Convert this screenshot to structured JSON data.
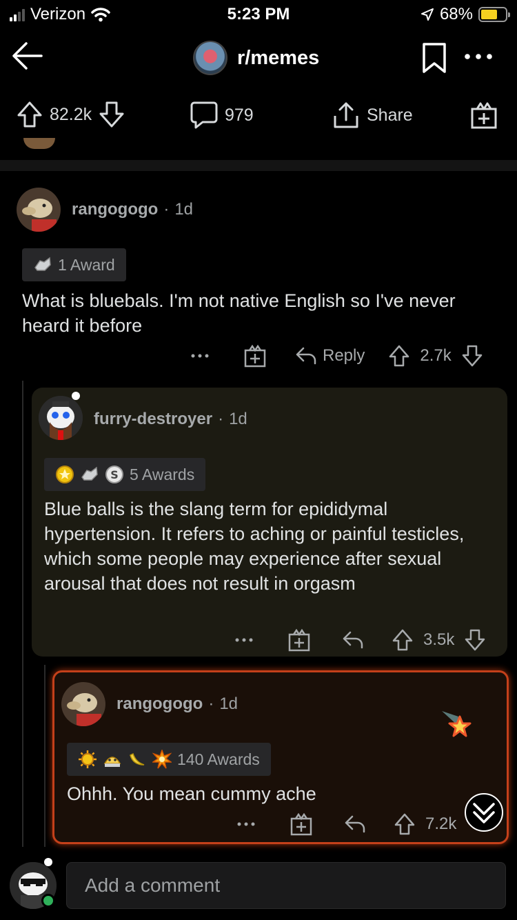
{
  "status": {
    "carrier": "Verizon",
    "time": "5:23 PM",
    "battery": "68%"
  },
  "header": {
    "subreddit": "r/memes"
  },
  "actionbar": {
    "score": "82.2k",
    "comments": "979",
    "share_label": "Share"
  },
  "comments": [
    {
      "author": "rangogogo",
      "age": "1d",
      "awards_label": "1 Award",
      "body": "What is bluebals. I'm not native English so I've never heard it before",
      "reply_label": "Reply",
      "score": "2.7k"
    },
    {
      "author": "furry-destroyer",
      "age": "1d",
      "awards_label": "5 Awards",
      "body": "Blue balls is the slang term for epididymal hypertension. It refers to aching or painful testicles, which some people may experience after sexual arousal that does not result in orgasm",
      "score": "3.5k"
    },
    {
      "author": "rangogogo",
      "age": "1d",
      "awards_label": "140 Awards",
      "body": "Ohhh. You mean cummy ache",
      "score": "7.2k"
    }
  ],
  "bottom": {
    "placeholder": "Add a comment"
  },
  "colors": {
    "background": "#000000",
    "highlight_border": "#c4401a",
    "online": "#2fb05a"
  }
}
